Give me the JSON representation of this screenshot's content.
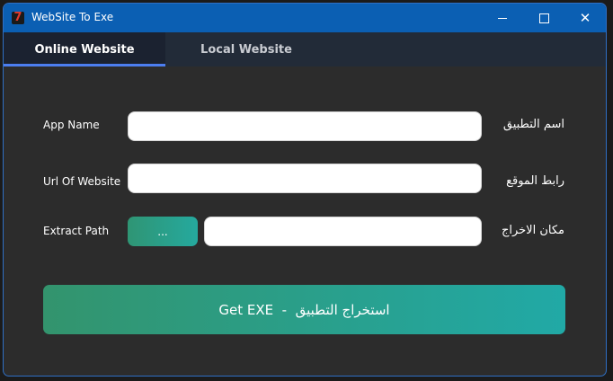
{
  "window": {
    "title": "WebSite To Exe",
    "logo_letter": "7",
    "close_glyph": "✕"
  },
  "tabs": [
    {
      "label": "Online Website",
      "active": true
    },
    {
      "label": "Local Website",
      "active": false
    }
  ],
  "form": {
    "app_name": {
      "label": "App Name",
      "label_ar": "اسم التطبيق",
      "value": ""
    },
    "url": {
      "label": "Url Of Website",
      "label_ar": "رابط الموقع",
      "value": ""
    },
    "extract_path": {
      "label": "Extract Path",
      "label_ar": "مكان الاخراج",
      "value": "",
      "browse_label": "..."
    }
  },
  "get_exe_button": {
    "label": "Get EXE  -  استخراج التطبيق"
  },
  "colors": {
    "titlebar": "#0b5fb3",
    "background": "#2c2c2c",
    "tab_active_underline": "#4c7ef0",
    "button_gradient_start": "#33946d",
    "button_gradient_end": "#21a9a6"
  }
}
